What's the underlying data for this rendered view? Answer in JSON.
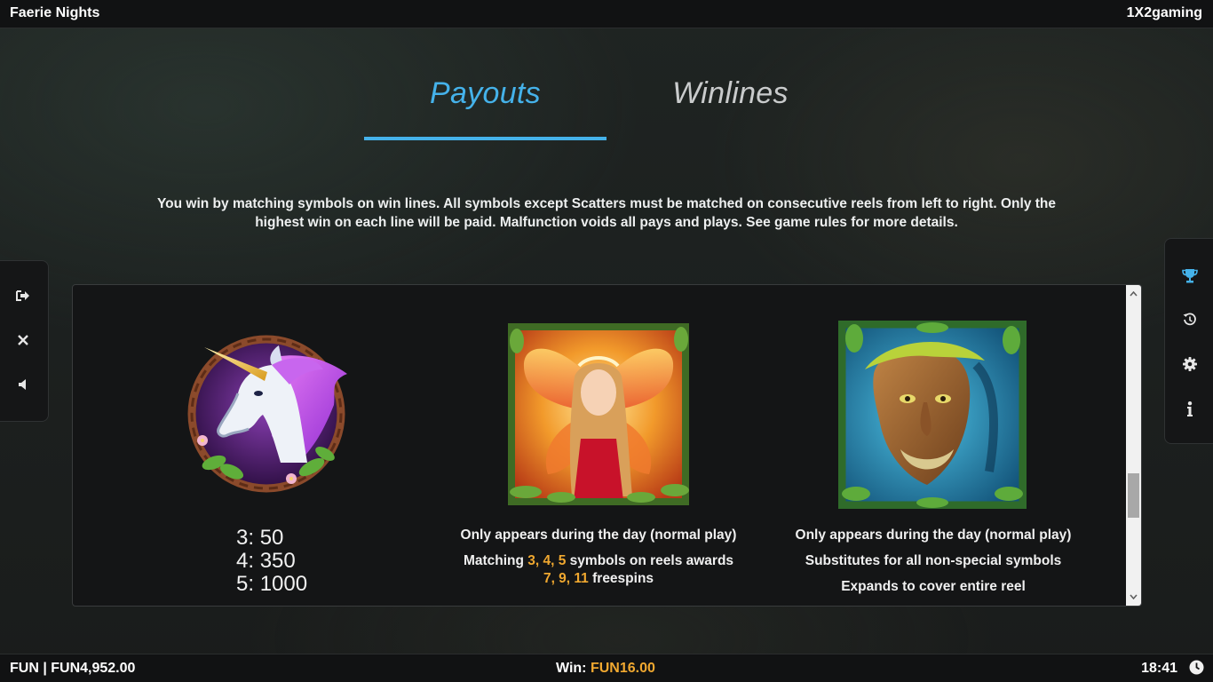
{
  "header": {
    "title": "Faerie Nights",
    "brand": "1X2gaming"
  },
  "tabs": [
    {
      "label": "Payouts",
      "active": true
    },
    {
      "label": "Winlines",
      "active": false
    }
  ],
  "accent_color": "#45b2ea",
  "highlight_color": "#f0a830",
  "intro_text": "You win by matching symbols on win lines. All symbols except Scatters must be matched on consecutive reels from left to right. Only the highest win on each line will be paid. Malfunction voids all pays and plays. See game rules for more details.",
  "left_sidebar": [
    {
      "icon": "exit-icon"
    },
    {
      "icon": "close-icon"
    },
    {
      "icon": "sound-icon"
    }
  ],
  "right_sidebar": [
    {
      "icon": "trophy-icon",
      "active": true
    },
    {
      "icon": "history-icon"
    },
    {
      "icon": "gear-icon"
    },
    {
      "icon": "info-icon"
    }
  ],
  "symbols": [
    {
      "icon": "unicorn-symbol",
      "payouts": [
        {
          "count": "3:",
          "value": "50"
        },
        {
          "count": "4:",
          "value": "350"
        },
        {
          "count": "5:",
          "value": "1000"
        }
      ]
    },
    {
      "icon": "fairy-scatter-symbol",
      "line1": "Only appears during the day (normal play)",
      "line2_pre": "Matching ",
      "line2_nums": "3, 4, 5",
      "line2_post": " symbols on reels awards",
      "line3_nums": "7, 9, 11",
      "line3_post": " freespins"
    },
    {
      "icon": "tree-spirit-wild-symbol",
      "line1": "Only appears during the day (normal play)",
      "line2": "Substitutes for all non-special symbols",
      "line3": "Expands to cover entire reel"
    }
  ],
  "footer": {
    "balance": "FUN | FUN4,952.00",
    "win_label": "Win: ",
    "win_value": "FUN16.00",
    "time": "18:41"
  }
}
